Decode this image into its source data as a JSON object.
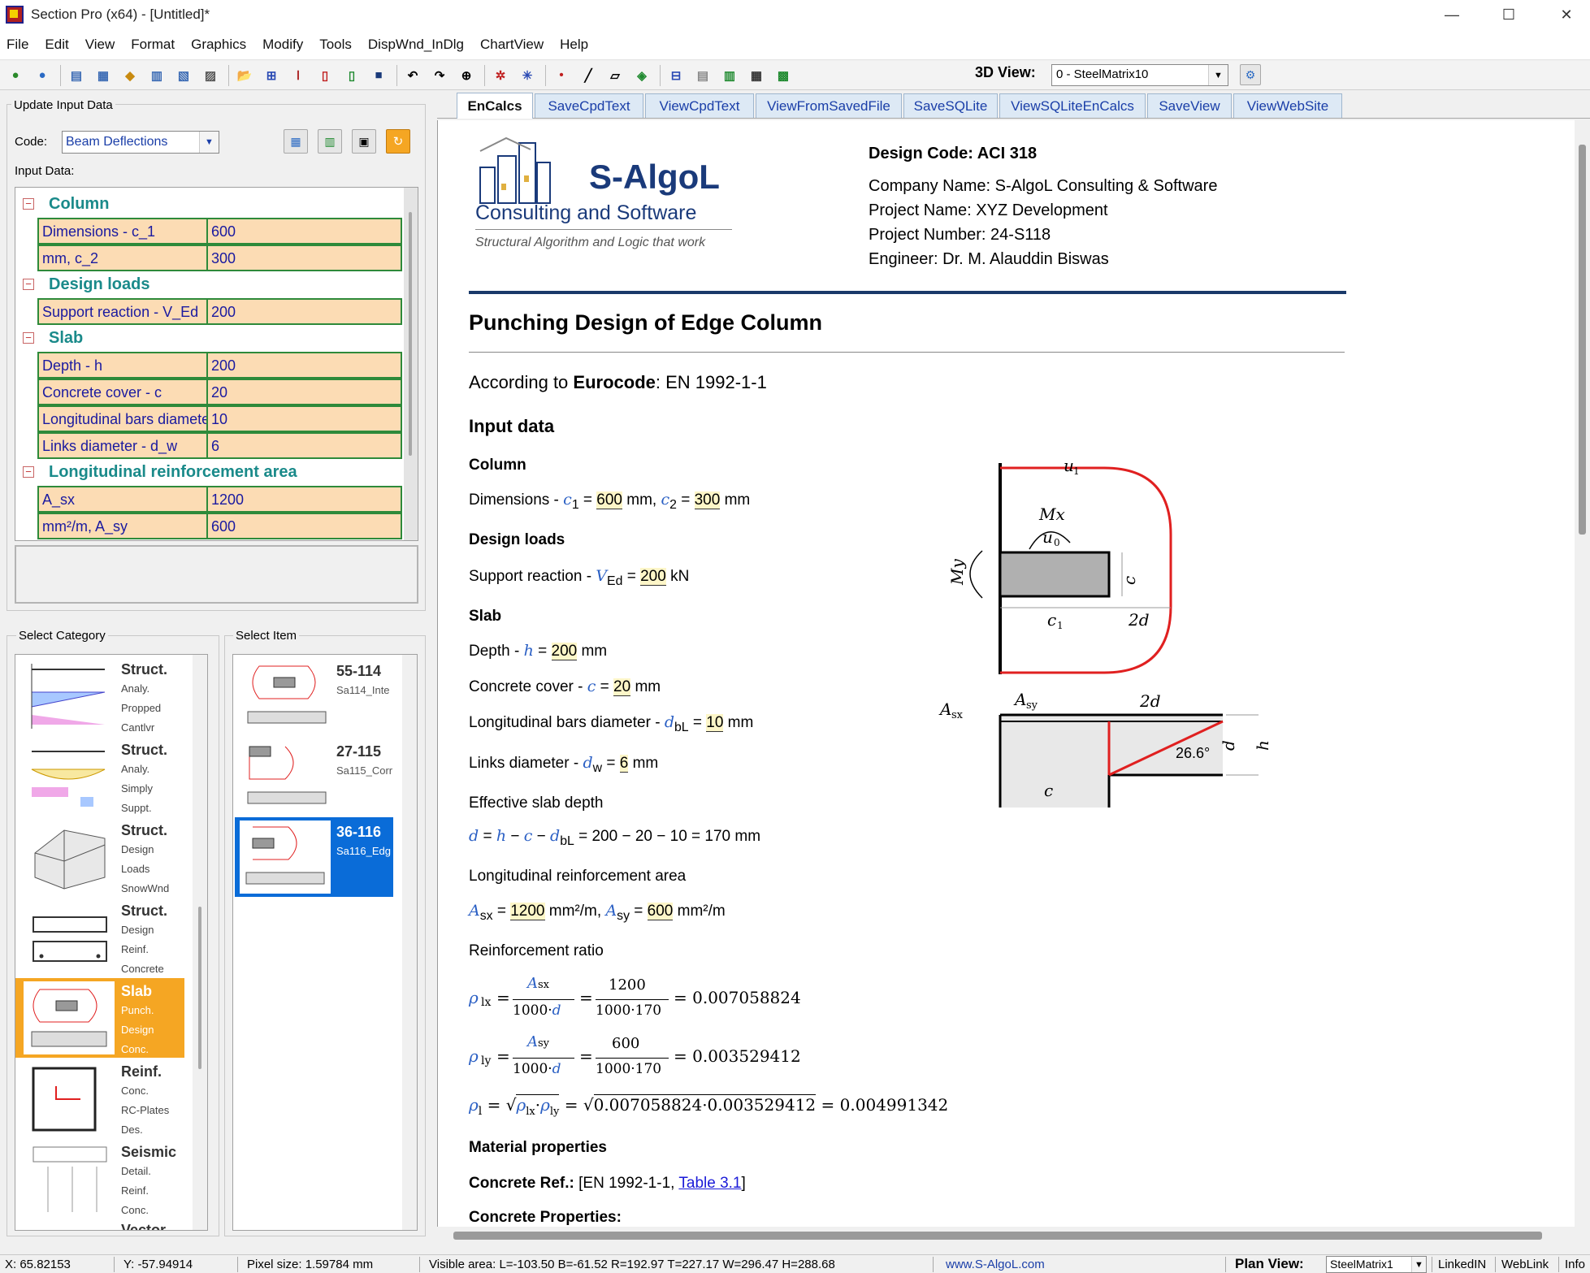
{
  "window": {
    "title": "Section Pro (x64) - [Untitled]*",
    "minimize": "—",
    "maximize": "☐",
    "close": "✕"
  },
  "menu": [
    "File",
    "Edit",
    "View",
    "Format",
    "Graphics",
    "Modify",
    "Tools",
    "DispWnd_InDlg",
    "ChartView",
    "Help"
  ],
  "toolbar": {
    "view3d_label": "3D View:",
    "view3d_value": "0 - SteelMatrix10"
  },
  "left": {
    "update_title": "Update Input Data",
    "code_label": "Code:",
    "code_value": "Beam Deflections",
    "input_label": "Input Data:",
    "grid": [
      {
        "category": "Column",
        "rows": [
          {
            "name": "Dimensions - c_1",
            "value": "600"
          },
          {
            "name": "mm, c_2",
            "value": "300"
          }
        ]
      },
      {
        "category": "Design loads",
        "rows": [
          {
            "name": "Support reaction - V_Ed",
            "value": "200"
          }
        ]
      },
      {
        "category": "Slab",
        "rows": [
          {
            "name": "Depth - h",
            "value": "200"
          },
          {
            "name": "Concrete cover - c",
            "value": "20"
          },
          {
            "name": "Longitudinal bars diameter",
            "value": "10"
          },
          {
            "name": "Links diameter - d_w",
            "value": "6"
          }
        ]
      },
      {
        "category": "Longitudinal reinforcement area",
        "rows": [
          {
            "name": " A_sx",
            "value": "1200"
          },
          {
            "name": "mm²/m, A_sy",
            "value": "600"
          }
        ]
      }
    ],
    "category_title": "Select Category",
    "item_title": "Select Item",
    "categories": [
      {
        "title": "Struct.",
        "lines": [
          "Analy.",
          "Propped",
          "Cantlvr"
        ]
      },
      {
        "title": "Struct.",
        "lines": [
          "Analy.",
          "Simply",
          "Suppt."
        ]
      },
      {
        "title": "Struct.",
        "lines": [
          "Design",
          "Loads",
          "SnowWnd"
        ]
      },
      {
        "title": "Struct.",
        "lines": [
          "Design",
          "Reinf.",
          "Concrete"
        ]
      },
      {
        "title": "Slab",
        "lines": [
          "Punch.",
          "Design",
          "Conc."
        ]
      },
      {
        "title": "Reinf.",
        "lines": [
          "Conc.",
          "RC-Plates",
          "Des."
        ]
      },
      {
        "title": "Seismic",
        "lines": [
          "Detail.",
          "Reinf.",
          "Conc."
        ]
      },
      {
        "title": "Vector",
        "lines": []
      }
    ],
    "items": [
      {
        "id": "55-114",
        "sub": "Sa114_Inte"
      },
      {
        "id": "27-115",
        "sub": "Sa115_Corr"
      },
      {
        "id": "36-116",
        "sub": "Sa116_Edg"
      }
    ]
  },
  "tabs": [
    "EnCalcs",
    "SaveCpdText",
    "ViewCpdText",
    "ViewFromSavedFile",
    "SaveSQLite",
    "ViewSQLiteEnCalcs",
    "SaveView",
    "ViewWebSite"
  ],
  "doc": {
    "logo_name": "S-AlgoL",
    "logo_tag": "Consulting and Software",
    "logo_slogan": "Structural Algorithm and Logic that work",
    "design_code": "Design Code: ACI 318",
    "company": "Company Name: S-AlgoL Consulting & Software",
    "project_name": "Project Name: XYZ Development",
    "project_number": "Project Number: 24-S118",
    "engineer": "Engineer: Dr. M. Alauddin Biswas",
    "heading": "Punching Design of Edge Column",
    "according_pre": "According to ",
    "according_bold": "Eurocode",
    "according_post": ": EN 1992-1-1",
    "input_heading": "Input data",
    "column_heading": "Column",
    "dim_label": "Dimensions - ",
    "c1_value": "600",
    "c2_value": "300",
    "unit_mm": "mm",
    "loads_heading": "Design loads",
    "support_label": "Support reaction - ",
    "ved_value": "200",
    "unit_kn": "kN",
    "slab_heading": "Slab",
    "depth_label": "Depth - ",
    "h_value": "200",
    "cover_label": "Concrete cover - ",
    "c_value": "20",
    "long_label": "Longitudinal bars diameter - ",
    "dbl_value": "10",
    "links_label": "Links diameter - ",
    "dw_value": "6",
    "eff_label": "Effective slab depth",
    "eff_formula": "= 200 − 20 − 10 = 170 mm",
    "area_label": "Longitudinal reinforcement area",
    "asx_value": "1200",
    "asy_value": "600",
    "unit_area": "mm²/m",
    "ratio_label": "Reinforcement ratio",
    "rlx_num": "1200",
    "rlx_den": "1000·170",
    "rlx_res": "= 0.007058824",
    "rly_num": "600",
    "rly_den": "1000·170",
    "rly_res": "= 0.003529412",
    "rl_inner": "0.007058824·0.003529412",
    "rl_res": "= 0.004991342",
    "mat_heading": "Material properties",
    "conc_ref_label": "Concrete Ref.:",
    "conc_ref_text": " [EN 1992-1-1, ",
    "conc_ref_link": "Table 3.1",
    "conc_ref_end": "]",
    "conc_props": "Concrete Properties:",
    "fig": {
      "u1": "u",
      "Mx": "Mx",
      "u0": "u",
      "My": "My",
      "c2": "c",
      "c1": "c",
      "twod": "2d",
      "Asx": "A",
      "Asy": "A",
      "angle": "26.6°",
      "d": "d",
      "h": "h"
    }
  },
  "status": {
    "x": "X: 65.82153",
    "y": "Y: -57.94914",
    "pixel": "Pixel size: 1.59784 mm",
    "visible": "Visible area:  L=-103.50  B=-61.52  R=192.97  T=227.17   W=296.47  H=288.68",
    "web": "www.S-AlgoL.com",
    "plan_label": "Plan View:",
    "plan_value": "SteelMatrix1",
    "linkedin": "LinkedIN",
    "weblink": "WebLink",
    "info": "Info"
  },
  "colors": {
    "accent_teal": "#1a8a8a",
    "grid_border": "#2e8a3a",
    "grid_fill": "#fcdcb4",
    "selection_blue": "#0a6cd8",
    "category_orange": "#f5a623",
    "perimeter_red": "#e02020"
  }
}
